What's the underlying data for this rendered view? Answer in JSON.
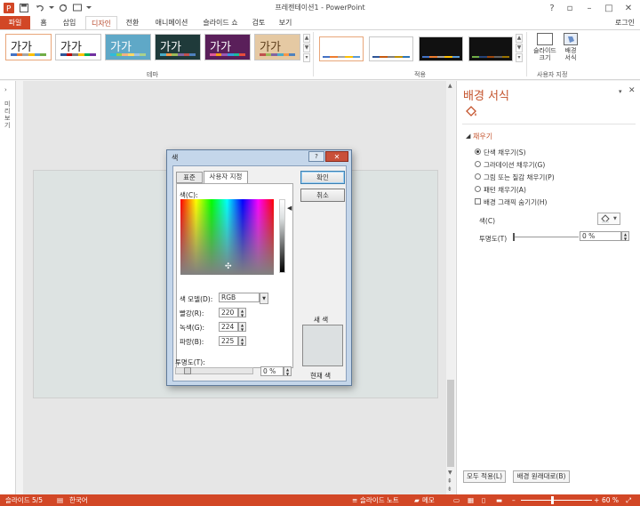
{
  "window": {
    "title": "프레젠테이션1 - PowerPoint",
    "login": "로그인"
  },
  "tabs": [
    "파일",
    "홈",
    "삽입",
    "디자인",
    "전환",
    "애니메이션",
    "슬라이드 쇼",
    "검토",
    "보기"
  ],
  "ribbon": {
    "themes": [
      {
        "label": "가가",
        "bg": "#ffffff",
        "fg": "#222222",
        "accent": [
          "#4472c4",
          "#ed7d31",
          "#a5a5a5",
          "#ffc000",
          "#5b9bd5",
          "#70ad47"
        ]
      },
      {
        "label": "가가",
        "bg": "#ffffff",
        "fg": "#222222",
        "accent": [
          "#2f5597",
          "#c00000",
          "#7f7f7f",
          "#ffc000",
          "#00b050",
          "#7030a0"
        ]
      },
      {
        "label": "가가",
        "bg": "#5fa8c7",
        "fg": "#ffffff",
        "accent": [
          "#2fbcd8",
          "#8fd14f",
          "#f4b183",
          "#ffd966",
          "#9dc3e6",
          "#a9d18e"
        ]
      },
      {
        "label": "가가",
        "bg": "#1f3a3a",
        "fg": "#ffffff",
        "accent": [
          "#4bacc6",
          "#f79646",
          "#9bbb59",
          "#8064a2",
          "#c0504d",
          "#4f81bd"
        ]
      },
      {
        "label": "가가",
        "bg": "#5a1f5a",
        "fg": "#ffffff",
        "accent": [
          "#e0589a",
          "#f39c12",
          "#9b59b6",
          "#3498db",
          "#1abc9c",
          "#e74c3c"
        ]
      },
      {
        "label": "가가",
        "bg": "#e5c9a3",
        "fg": "#5a3b1a",
        "accent": [
          "#c0504d",
          "#9bbb59",
          "#8064a2",
          "#4bacc6",
          "#f79646",
          "#4f81bd"
        ]
      }
    ],
    "theme_group_label": "테마",
    "variant_group_label": "적용",
    "custom_group_label": "사용자 지정",
    "slide_size_label": "슬라이드\n크기",
    "bg_format_label": "배경\n서식"
  },
  "left_strip": {
    "label": "미리보기"
  },
  "pane": {
    "title": "배경 서식",
    "section": "채우기",
    "options": [
      {
        "label": "단색 채우기(S)",
        "selected": true
      },
      {
        "label": "그라데이션 채우기(G)",
        "selected": false
      },
      {
        "label": "그림 또는 질감 채우기(P)",
        "selected": false
      },
      {
        "label": "패턴 채우기(A)",
        "selected": false
      }
    ],
    "hide_bg_label": "배경 그래픽 숨기기(H)",
    "color_label": "색(C)",
    "transparency_label": "투명도(T)",
    "transparency_value": "0 %",
    "apply_all": "모두 적용(L)",
    "reset_bg": "배경 원래대로(B)"
  },
  "dialog": {
    "title": "색",
    "tab_standard": "표준",
    "tab_custom": "사용자 지정",
    "ok": "확인",
    "cancel": "취소",
    "colors_label": "색(C):",
    "model_label": "색 모델(D):",
    "model_value": "RGB",
    "red_label": "빨강(R):",
    "red_value": "220",
    "green_label": "녹색(G):",
    "green_value": "224",
    "blue_label": "파랑(B):",
    "blue_value": "225",
    "transparency_label": "투명도(T):",
    "transparency_value": "0 %",
    "new_label": "새 색",
    "current_label": "현재 색",
    "current_color": "#dce0e1"
  },
  "status": {
    "slide": "슬라이드 5/5",
    "lang": "한국어",
    "notes": "슬라이드 노트",
    "memo": "메모",
    "zoom": "60 %"
  }
}
